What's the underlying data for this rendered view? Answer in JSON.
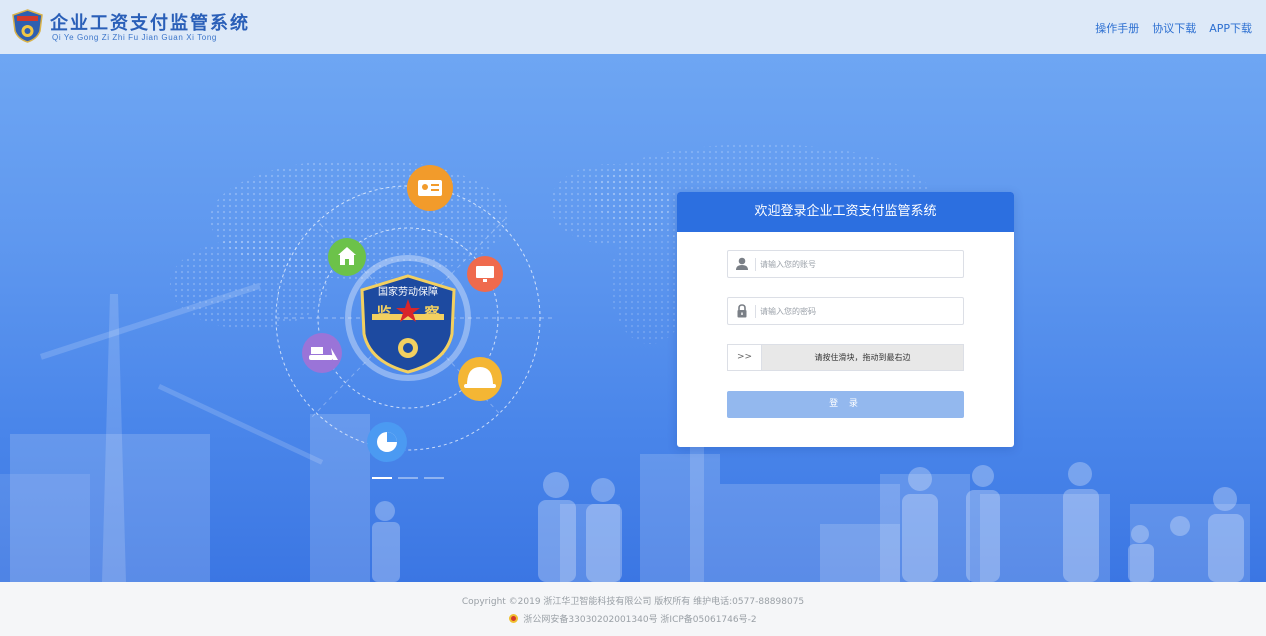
{
  "header": {
    "title": "企业工资支付监管系统",
    "subtitle": "Qi Ye Gong Zi Zhi Fu Jian Guan Xi Tong",
    "links": [
      "操作手册",
      "协议下载",
      "APP下载"
    ]
  },
  "emblem": {
    "line1": "国家劳动保障",
    "line2_left": "监",
    "line2_right": "察"
  },
  "login": {
    "title": "欢迎登录企业工资支付监管系统",
    "username_placeholder": "请输入您的账号",
    "password_placeholder": "请输入您的密码",
    "slider_handle": ">>",
    "slider_text": "请按住滑块，拖动到最右边",
    "submit_label": "登 录"
  },
  "footer": {
    "copyright": "Copyright ©2019 浙江华卫智能科技有限公司 版权所有 维护电话:0577-88898075",
    "beian": "浙公网安备33030202001340号 浙ICP备05061746号-2"
  },
  "colors": {
    "header_bg": "#dde9f8",
    "primary": "#2c6fe0",
    "button_disabled": "#93b8ee",
    "orbit_icon_orange": "#f29b2b",
    "orbit_icon_green": "#6cc24a",
    "orbit_icon_red": "#ef6a4d",
    "orbit_icon_purple": "#9a74d8",
    "orbit_icon_yellow": "#f4b634",
    "orbit_icon_blue": "#4b9af2"
  },
  "icons": [
    "badge-logo-icon",
    "id-card-icon",
    "house-icon",
    "monitor-icon",
    "bulldozer-icon",
    "helmet-icon",
    "pie-chart-icon",
    "user-icon",
    "lock-icon",
    "police-badge-icon"
  ]
}
